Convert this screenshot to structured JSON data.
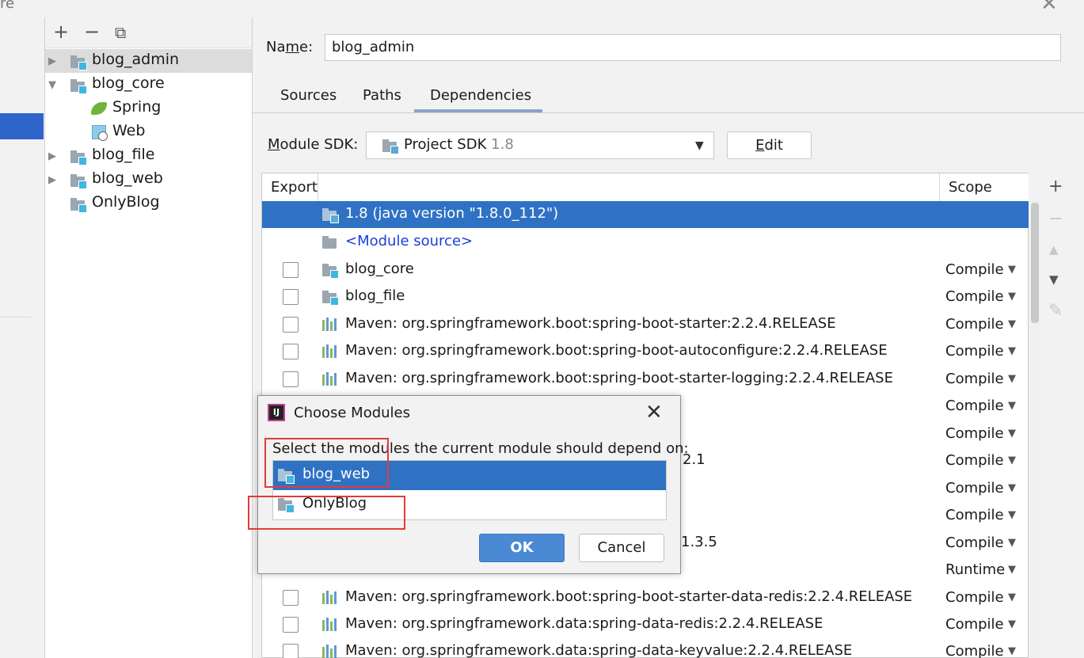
{
  "window": {
    "title_fragment": "re",
    "close_glyph": "✕"
  },
  "tree": {
    "toolbar": {
      "add": "+",
      "remove": "−",
      "copy": "⧉"
    },
    "items": [
      {
        "label": "blog_admin",
        "expanded": false
      },
      {
        "label": "blog_core",
        "expanded": true
      },
      {
        "label": "Spring"
      },
      {
        "label": "Web"
      },
      {
        "label": "blog_file",
        "expanded": false
      },
      {
        "label": "blog_web",
        "expanded": false
      },
      {
        "label": "OnlyBlog"
      }
    ]
  },
  "form": {
    "name_label_pre": "Na",
    "name_label_ul": "m",
    "name_label_post": "e:",
    "name_value": "blog_admin",
    "tabs": [
      "Sources",
      "Paths",
      "Dependencies"
    ],
    "active_tab": "Dependencies",
    "sdk_label_ul": "M",
    "sdk_label_rest": "odule SDK:",
    "sdk_value": "Project SDK",
    "sdk_version": "1.8",
    "edit_ul": "E",
    "edit_rest": "dit"
  },
  "table": {
    "headers": {
      "export": "Export",
      "scope": "Scope"
    },
    "rows": [
      {
        "label": "1.8 (java version \"1.8.0_112\")",
        "kind": "sdk",
        "scope": ""
      },
      {
        "label": "<Module source>",
        "kind": "source",
        "scope": ""
      },
      {
        "label": "blog_core",
        "kind": "module",
        "scope": "Compile"
      },
      {
        "label": "blog_file",
        "kind": "module",
        "scope": "Compile"
      },
      {
        "label": "Maven: org.springframework.boot:spring-boot-starter:2.2.4.RELEASE",
        "kind": "maven",
        "scope": "Compile"
      },
      {
        "label": "Maven: org.springframework.boot:spring-boot-autoconfigure:2.2.4.RELEASE",
        "kind": "maven",
        "scope": "Compile"
      },
      {
        "label": "Maven: org.springframework.boot:spring-boot-starter-logging:2.2.4.RELEASE",
        "kind": "maven",
        "scope": "Compile"
      },
      {
        "label": "",
        "kind": "maven",
        "scope": "Compile"
      },
      {
        "label": "",
        "kind": "maven",
        "scope": "Compile"
      },
      {
        "label": "2.1",
        "kind": "maven",
        "scope": "Compile"
      },
      {
        "label": "",
        "kind": "maven",
        "scope": "Compile"
      },
      {
        "label": "",
        "kind": "maven",
        "scope": "Compile"
      },
      {
        "label": "1.3.5",
        "kind": "maven",
        "scope": "Compile"
      },
      {
        "label": "",
        "kind": "maven",
        "scope": "Runtime"
      },
      {
        "label": "Maven: org.springframework.boot:spring-boot-starter-data-redis:2.2.4.RELEASE",
        "kind": "maven",
        "scope": "Compile"
      },
      {
        "label": "Maven: org.springframework.data:spring-data-redis:2.2.4.RELEASE",
        "kind": "maven",
        "scope": "Compile"
      },
      {
        "label": "Maven: org.springframework.data:spring-data-keyvalue:2.2.4.RELEASE",
        "kind": "maven",
        "scope": "Compile"
      }
    ],
    "side_toolbar": {
      "add": "+",
      "remove": "−",
      "up": "▲",
      "down": "▼",
      "edit": "✎"
    }
  },
  "dialog": {
    "logo_text": "IJ",
    "title": "Choose Modules",
    "close_glyph": "✕",
    "prompt": "Select the modules the current module should depend on:",
    "items": [
      {
        "label": "blog_web",
        "selected": true
      },
      {
        "label": "OnlyBlog",
        "selected": false
      }
    ],
    "ok_label": "OK",
    "cancel_label": "Cancel"
  },
  "colors": {
    "selection": "#2f72c4",
    "annotation_red": "#e23a3a",
    "module_source_blue": "#1a3ed8"
  }
}
